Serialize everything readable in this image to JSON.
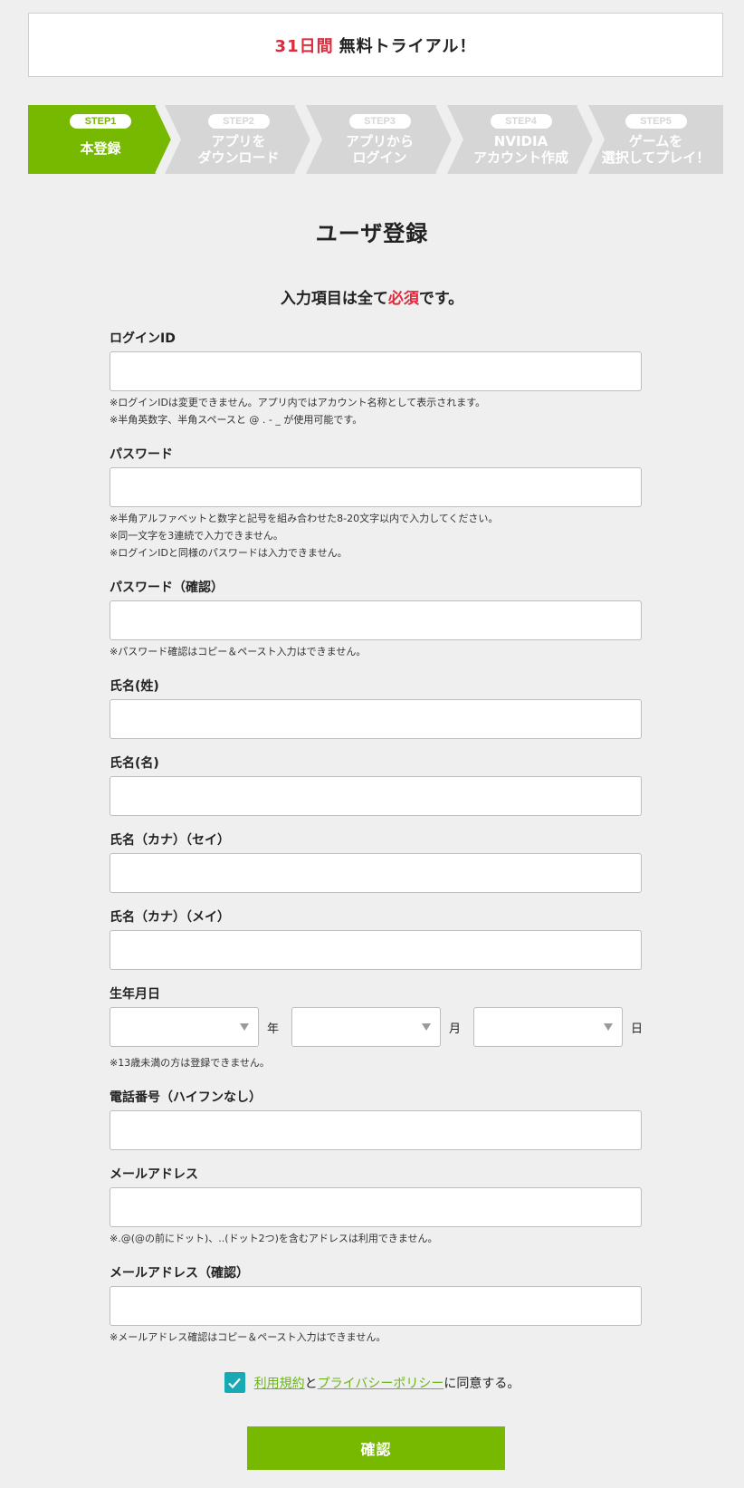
{
  "trial": {
    "highlight": "31日間",
    "text": "無料トライアル！"
  },
  "steps": [
    {
      "badge": "STEP1",
      "label": "本登録",
      "active": true
    },
    {
      "badge": "STEP2",
      "label": "アプリを\nダウンロード",
      "active": false
    },
    {
      "badge": "STEP3",
      "label": "アプリから\nログイン",
      "active": false
    },
    {
      "badge": "STEP4",
      "label": "NVIDIA\nアカウント作成",
      "active": false
    },
    {
      "badge": "STEP5",
      "label": "ゲームを\n選択してプレイ！",
      "active": false
    }
  ],
  "colors": {
    "accent": "#76b900",
    "inactive": "#d6d6d6",
    "required": "#e02a3c",
    "checkbox": "#17a9b4"
  },
  "title": "ユーザ登録",
  "required_note": {
    "before": "入力項目は全て",
    "highlight": "必須",
    "after": "です。"
  },
  "fields": {
    "login_id": {
      "label": "ログインID",
      "value": "",
      "notes": [
        "※ログインIDは変更できません。アプリ内ではアカウント名称として表示されます。",
        "※半角英数字、半角スペースと @ . - _ が使用可能です。"
      ]
    },
    "password": {
      "label": "パスワード",
      "value": "",
      "notes": [
        "※半角アルファベットと数字と記号を組み合わせた8-20文字以内で入力してください。",
        "※同一文字を3連続で入力できません。",
        "※ログインIDと同様のパスワードは入力できません。"
      ]
    },
    "password_confirm": {
      "label": "パスワード（確認）",
      "value": "",
      "notes": [
        "※パスワード確認はコピー＆ペースト入力はできません。"
      ]
    },
    "last_name": {
      "label": "氏名(姓)",
      "value": ""
    },
    "first_name": {
      "label": "氏名(名)",
      "value": ""
    },
    "last_name_kana": {
      "label": "氏名（カナ）（セイ）",
      "value": ""
    },
    "first_name_kana": {
      "label": "氏名（カナ）（メイ）",
      "value": ""
    },
    "birthday": {
      "label": "生年月日",
      "year_unit": "年",
      "month_unit": "月",
      "day_unit": "日",
      "year_value": "",
      "month_value": "",
      "day_value": "",
      "notes": [
        "※13歳未満の方は登録できません。"
      ]
    },
    "phone": {
      "label": "電話番号（ハイフンなし）",
      "value": ""
    },
    "email": {
      "label": "メールアドレス",
      "value": "",
      "notes": [
        "※.@(@の前にドット)、..(ドット2つ)を含むアドレスは利用できません。"
      ]
    },
    "email_confirm": {
      "label": "メールアドレス（確認）",
      "value": "",
      "notes": [
        "※メールアドレス確認はコピー＆ペースト入力はできません。"
      ]
    }
  },
  "agreement": {
    "checked": true,
    "terms_link": "利用規約",
    "connector": "と",
    "privacy_link": "プライバシーポリシー",
    "suffix": "に同意する。"
  },
  "confirm_label": "確認"
}
